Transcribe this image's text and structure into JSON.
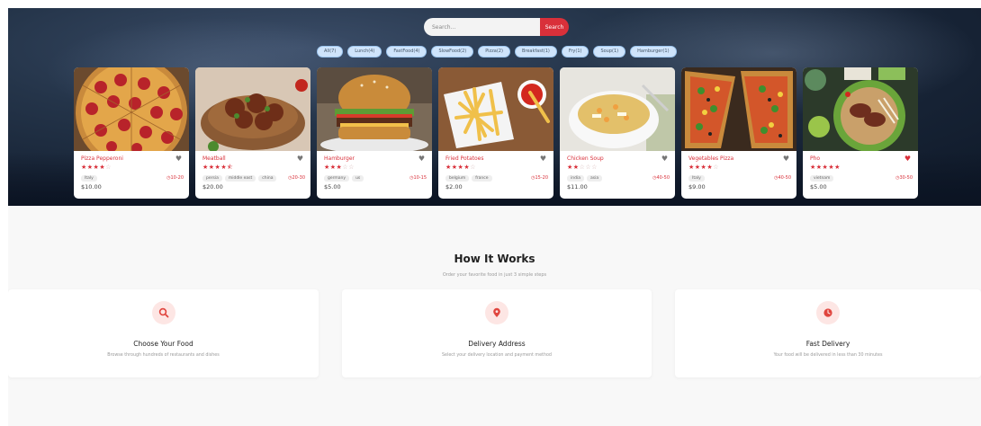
{
  "search": {
    "placeholder": "Search...",
    "button_label": "Search"
  },
  "filters": [
    "All(7)",
    "Lunch(4)",
    "FastFood(4)",
    "SlowFood(2)",
    "Pizza(2)",
    "Breakfast(1)",
    "Fry(1)",
    "Soup(1)",
    "Hamburger(1)"
  ],
  "foods": [
    {
      "name": "Pizza Pepperoni",
      "rating": 4,
      "tags": [
        "Italy"
      ],
      "time": "10-20",
      "price": "$10.00",
      "favorite": false,
      "image_icon": "pizza-pepperoni-photo"
    },
    {
      "name": "Meatball",
      "rating": 4.5,
      "tags": [
        "persia",
        "middle east",
        "china"
      ],
      "time": "20-30",
      "price": "$20.00",
      "favorite": false,
      "image_icon": "meatball-photo"
    },
    {
      "name": "Hamburger",
      "rating": 3,
      "tags": [
        "germany",
        "us"
      ],
      "time": "10-15",
      "price": "$5.00",
      "favorite": false,
      "image_icon": "hamburger-photo"
    },
    {
      "name": "Fried Potatoes",
      "rating": 4,
      "tags": [
        "belgium",
        "france"
      ],
      "time": "15-20",
      "price": "$2.00",
      "favorite": false,
      "image_icon": "fries-photo"
    },
    {
      "name": "Chicken Soup",
      "rating": 2,
      "tags": [
        "india",
        "asia"
      ],
      "time": "40-50",
      "price": "$11.00",
      "favorite": false,
      "image_icon": "soup-photo"
    },
    {
      "name": "Vegetables Pizza",
      "rating": 4,
      "tags": [
        "Italy"
      ],
      "time": "40-50",
      "price": "$9.00",
      "favorite": false,
      "image_icon": "veggie-pizza-photo"
    },
    {
      "name": "Pho",
      "rating": 5,
      "tags": [
        "vietnam"
      ],
      "time": "30-50",
      "price": "$5.00",
      "favorite": true,
      "image_icon": "pho-photo"
    }
  ],
  "how": {
    "title": "How It Works",
    "subtitle": "Order your favorite food in just 3 simple steps",
    "steps": [
      {
        "title": "Choose Your Food",
        "desc": "Browse through hundreds of restaurants and dishes",
        "icon": "search-icon"
      },
      {
        "title": "Delivery Address",
        "desc": "Select your delivery location and payment method",
        "icon": "location-pin-icon"
      },
      {
        "title": "Fast Delivery",
        "desc": "Your food will be delivered in less than 30 minutes",
        "icon": "clock-icon"
      }
    ]
  },
  "colors": {
    "accent": "#d9303a",
    "chip_bg": "#cfe4fb",
    "icon_bg": "#fde6e4"
  }
}
